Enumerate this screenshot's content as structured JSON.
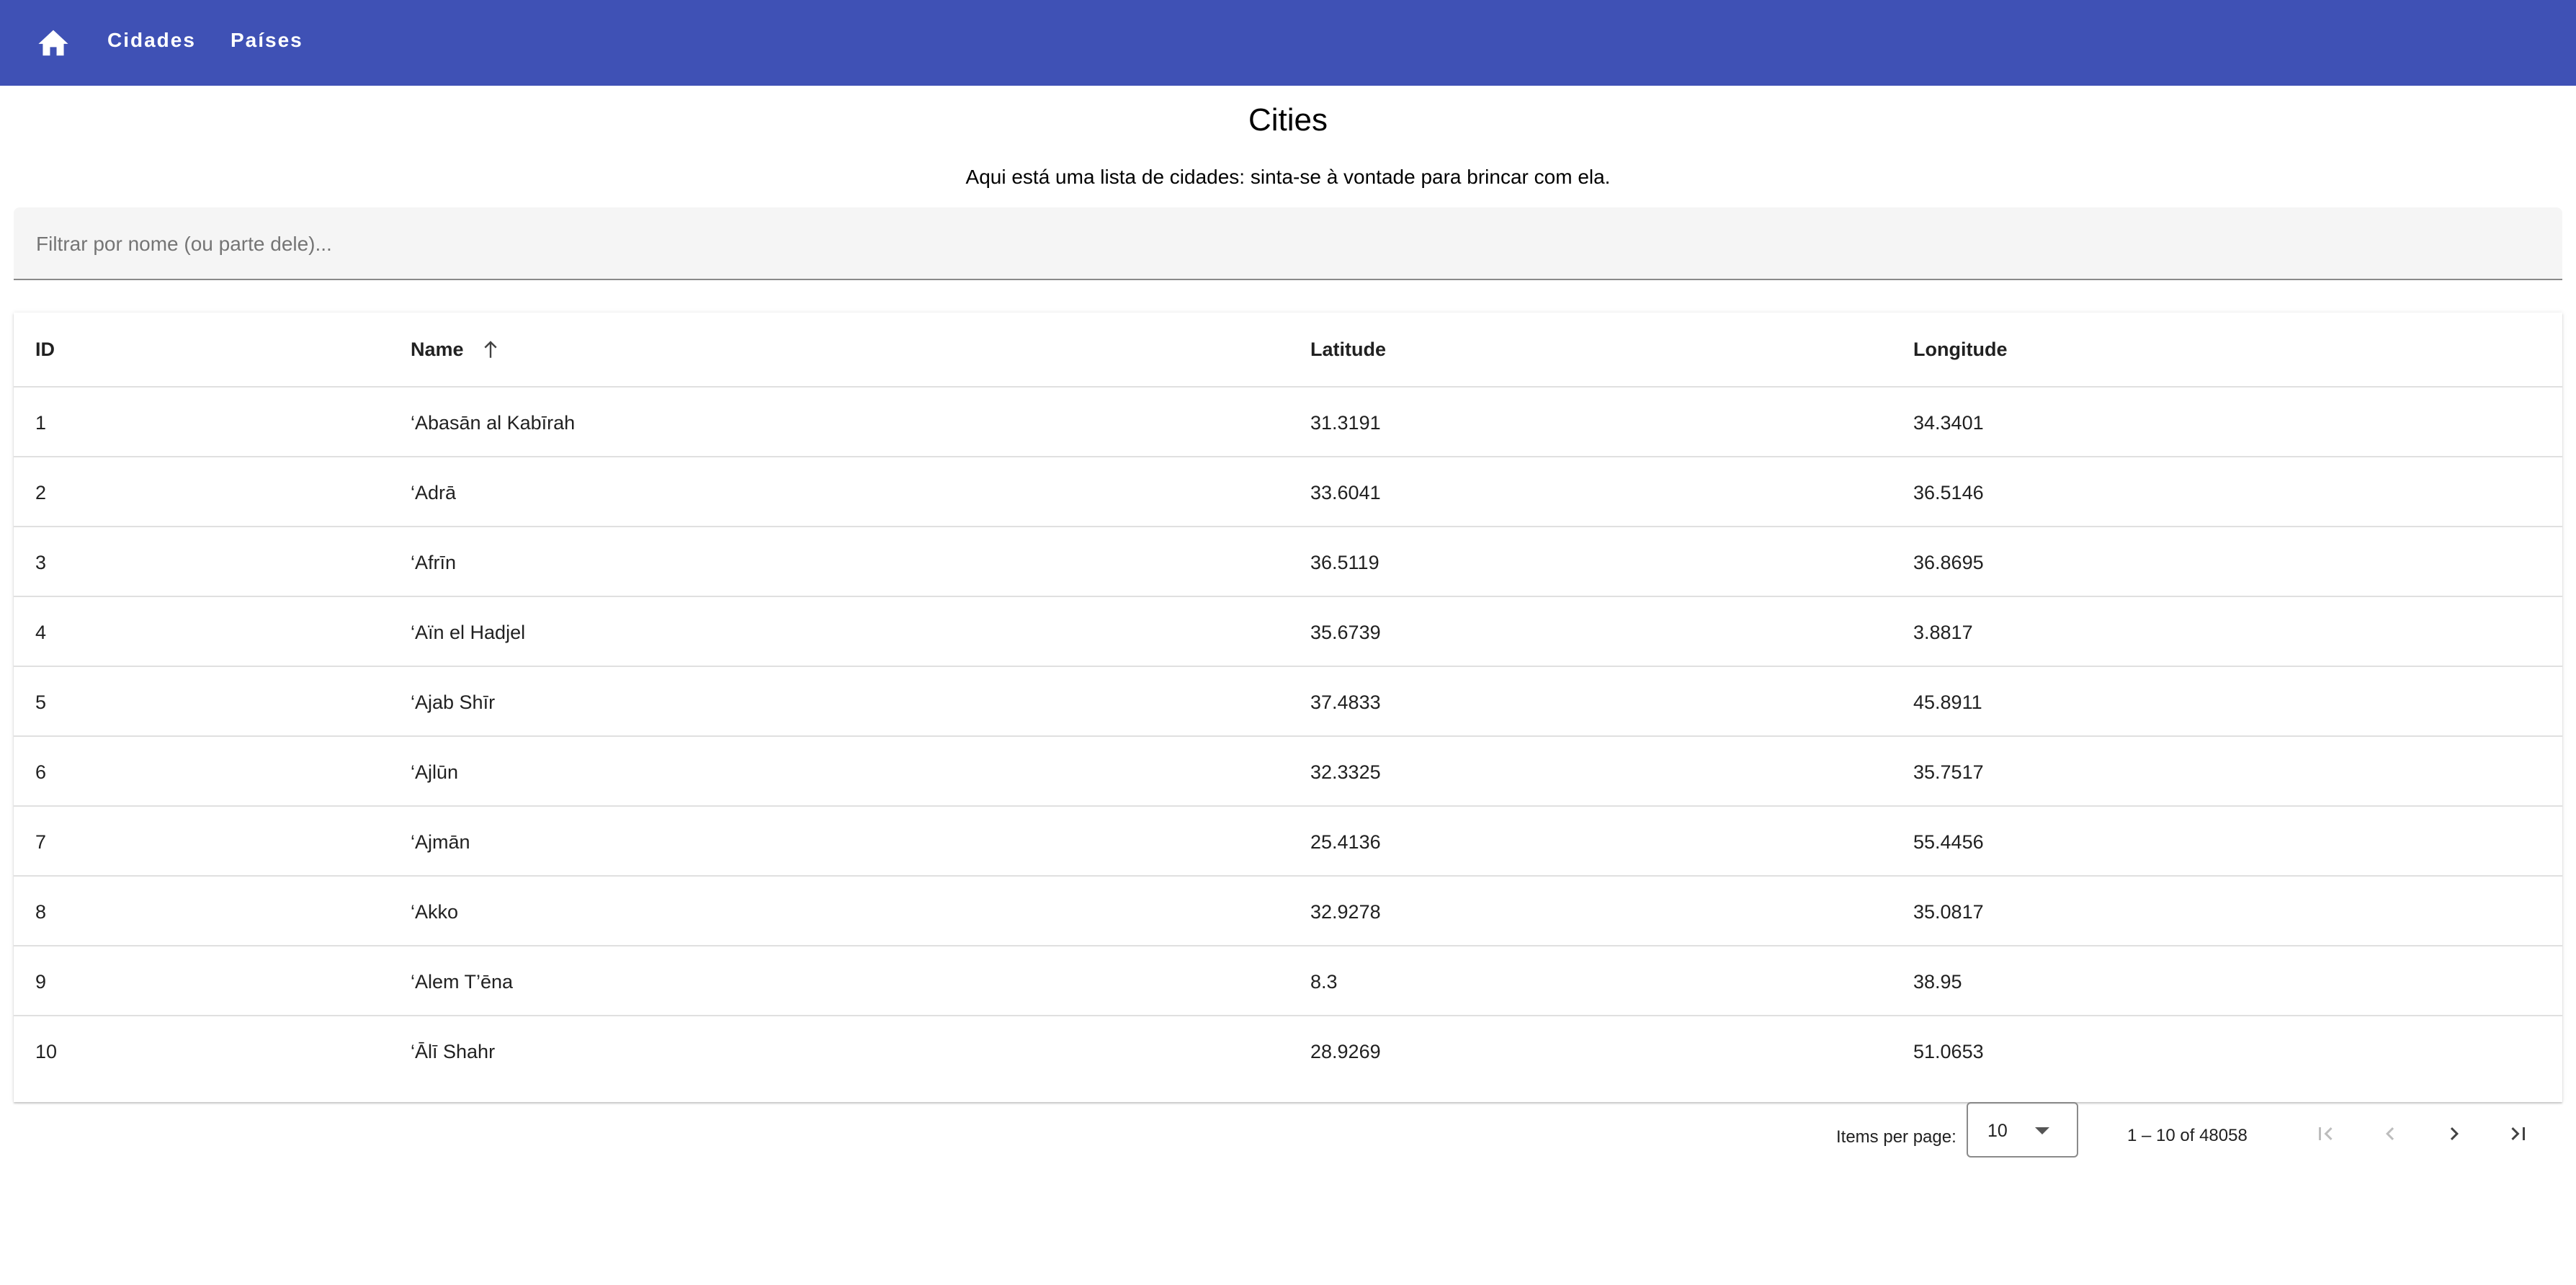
{
  "colors": {
    "toolbar": "#3f51b5",
    "toolbar_text": "#ffffff",
    "disabled_icon": "#bdbdbd",
    "enabled_icon": "#424242"
  },
  "nav": {
    "home_icon": "home-icon",
    "links": [
      "Cidades",
      "Países"
    ]
  },
  "page": {
    "title": "Cities",
    "subtitle": "Aqui está uma lista de cidades: sinta-se à vontade para brincar com ela."
  },
  "filter": {
    "placeholder": "Filtrar por nome (ou parte dele)...",
    "value": ""
  },
  "table": {
    "columns": [
      "ID",
      "Name",
      "Latitude",
      "Longitude"
    ],
    "sorted_column": "Name",
    "sort_direction": "ascending",
    "rows": [
      {
        "id": "1",
        "name": "‘Abasān al Kabīrah",
        "lat": "31.3191",
        "lon": "34.3401"
      },
      {
        "id": "2",
        "name": "‘Adrā",
        "lat": "33.6041",
        "lon": "36.5146"
      },
      {
        "id": "3",
        "name": "‘Afrīn",
        "lat": "36.5119",
        "lon": "36.8695"
      },
      {
        "id": "4",
        "name": "‘Aïn el Hadjel",
        "lat": "35.6739",
        "lon": "3.8817"
      },
      {
        "id": "5",
        "name": "‘Ajab Shīr",
        "lat": "37.4833",
        "lon": "45.8911"
      },
      {
        "id": "6",
        "name": "‘Ajlūn",
        "lat": "32.3325",
        "lon": "35.7517"
      },
      {
        "id": "7",
        "name": "‘Ajmān",
        "lat": "25.4136",
        "lon": "55.4456"
      },
      {
        "id": "8",
        "name": "‘Akko",
        "lat": "32.9278",
        "lon": "35.0817"
      },
      {
        "id": "9",
        "name": "‘Alem T’ēna",
        "lat": "8.3",
        "lon": "38.95"
      },
      {
        "id": "10",
        "name": "‘Ālī Shahr",
        "lat": "28.9269",
        "lon": "51.0653"
      }
    ]
  },
  "paginator": {
    "items_per_page_label": "Items per page:",
    "page_size": "10",
    "range_label": "1 – 10 of 48058"
  }
}
